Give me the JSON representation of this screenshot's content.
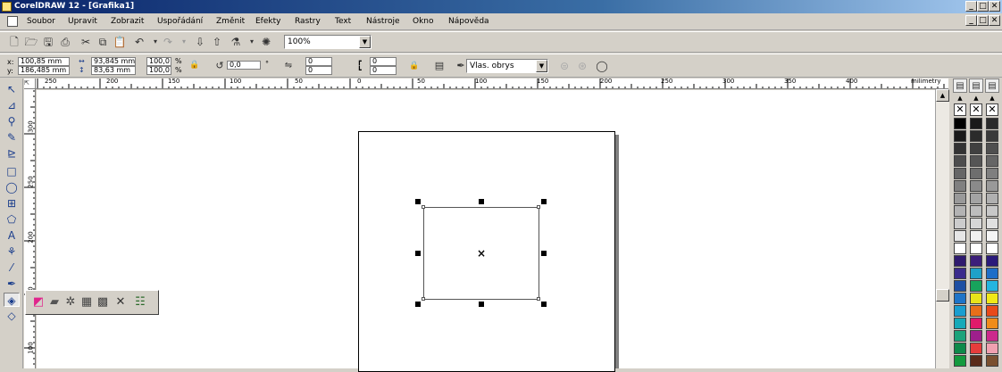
{
  "window": {
    "title": "CorelDRAW 12 - [Grafika1]",
    "buttons": [
      "_",
      "□",
      "✕"
    ],
    "doc_buttons": [
      "_",
      "□",
      "✕"
    ]
  },
  "menu": [
    "Soubor",
    "Upravit",
    "Zobrazit",
    "Uspořádání",
    "Změnit",
    "Efekty",
    "Rastry",
    "Text",
    "Nástroje",
    "Okno",
    "Nápověda"
  ],
  "standard_toolbar": {
    "zoom_value": "100%"
  },
  "property_bar": {
    "x_label": "x:",
    "x_value": "100,85 mm",
    "y_label": "y:",
    "y_value": "186,485 mm",
    "width_value": "93,845 mm",
    "height_value": "83,63 mm",
    "scale_x": "100,0",
    "scale_y": "100,0",
    "percent": "%",
    "rotation": "0,0",
    "degree": "°",
    "corner_tl": "0",
    "corner_bl": "0",
    "corner_tr": "0",
    "corner_br": "0",
    "outline_label": "Vlas. obrys"
  },
  "ruler": {
    "h_labels": [
      "250",
      "200",
      "150",
      "100",
      "50",
      "0",
      "50",
      "100",
      "150",
      "200",
      "250",
      "300",
      "350",
      "400"
    ],
    "units": "milimetry",
    "v_labels": [
      "300",
      "250",
      "200",
      "150",
      "100"
    ]
  },
  "colors": {
    "canvas": "#ffffff",
    "page_shadow": "#808080"
  },
  "palette_swatches": [
    [
      "#000000",
      "#1a1a1a",
      "#333333",
      "#4d4d4d",
      "#666666",
      "#808080",
      "#999999",
      "#b3b3b3",
      "#cccccc",
      "#e6e6e6",
      "#ffffff",
      "#2e1a6e",
      "#3a2b8c",
      "#1e4fa3",
      "#1e74c8",
      "#1a9ed0",
      "#16a9b8",
      "#1ba37a",
      "#0e8a4a",
      "#139a3e"
    ],
    [
      "#1a1a1a",
      "#2b2b2b",
      "#404040",
      "#555555",
      "#6e6e6e",
      "#8a8a8a",
      "#a3a3a3",
      "#bdbdbd",
      "#d6d6d6",
      "#efefef",
      "#ffffff",
      "#3c1f7a",
      "#1ea1c8",
      "#17a35c",
      "#e8e31a",
      "#e86f1a",
      "#e01a6a",
      "#9e1f8c",
      "#e63c3c",
      "#5a2b1a"
    ],
    [
      "#2a2a2a",
      "#3a3a3a",
      "#4f4f4f",
      "#666666",
      "#7f7f7f",
      "#999999",
      "#b0b0b0",
      "#c8c8c8",
      "#e0e0e0",
      "#f5f5f5",
      "#ffffff",
      "#2a1a7a",
      "#1e6ec8",
      "#24b5e0",
      "#f0e818",
      "#e84a1a",
      "#f08c1a",
      "#cc2a8c",
      "#f0a0b0",
      "#7a5030"
    ]
  ]
}
